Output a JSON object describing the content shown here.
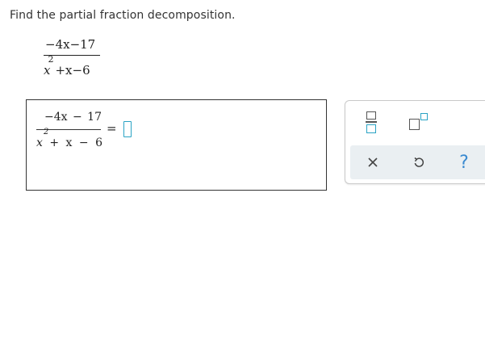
{
  "prompt": "Find the partial fraction decomposition.",
  "problem": {
    "numerator": "−4x−17",
    "denominator_base": "x",
    "denominator_exponent": "2",
    "denominator_rest": "+x−6"
  },
  "answer": {
    "numerator": "−4x − 17",
    "denominator_base": "x",
    "denominator_exponent": "2",
    "denominator_rest": "+ x − 6",
    "equals": "=",
    "input_value": ""
  },
  "toolbar": {
    "buttons": [
      "fraction-icon",
      "exponent-icon"
    ],
    "actions": [
      "close-icon",
      "undo-icon",
      "help-icon"
    ],
    "help_label": "?"
  },
  "colors": {
    "accent": "#2aa3c4",
    "help": "#3a8ad0",
    "action_bg": "#eaeff2"
  }
}
